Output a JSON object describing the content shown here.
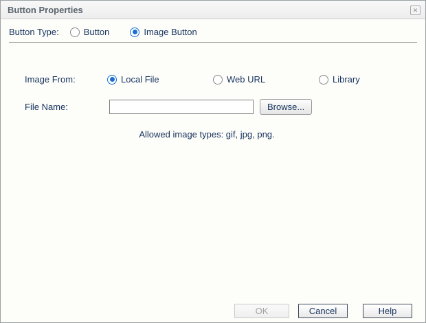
{
  "dialog": {
    "title": "Button Properties",
    "close_icon": "✕"
  },
  "button_type": {
    "label": "Button Type:",
    "options": [
      {
        "label": "Button",
        "selected": false
      },
      {
        "label": "Image Button",
        "selected": true
      }
    ]
  },
  "image_from": {
    "label": "Image From:",
    "options": [
      {
        "label": "Local File",
        "selected": true
      },
      {
        "label": "Web URL",
        "selected": false
      },
      {
        "label": "Library",
        "selected": false
      }
    ]
  },
  "file_name": {
    "label": "File Name:",
    "value": "",
    "browse_label": "Browse..."
  },
  "note": "Allowed image types: gif, jpg, png.",
  "footer": {
    "ok_label": "OK",
    "cancel_label": "Cancel",
    "help_label": "Help"
  },
  "colors": {
    "accent_blue": "#1b6fd4",
    "label_text": "#16335c",
    "title_text": "#5a646e"
  }
}
